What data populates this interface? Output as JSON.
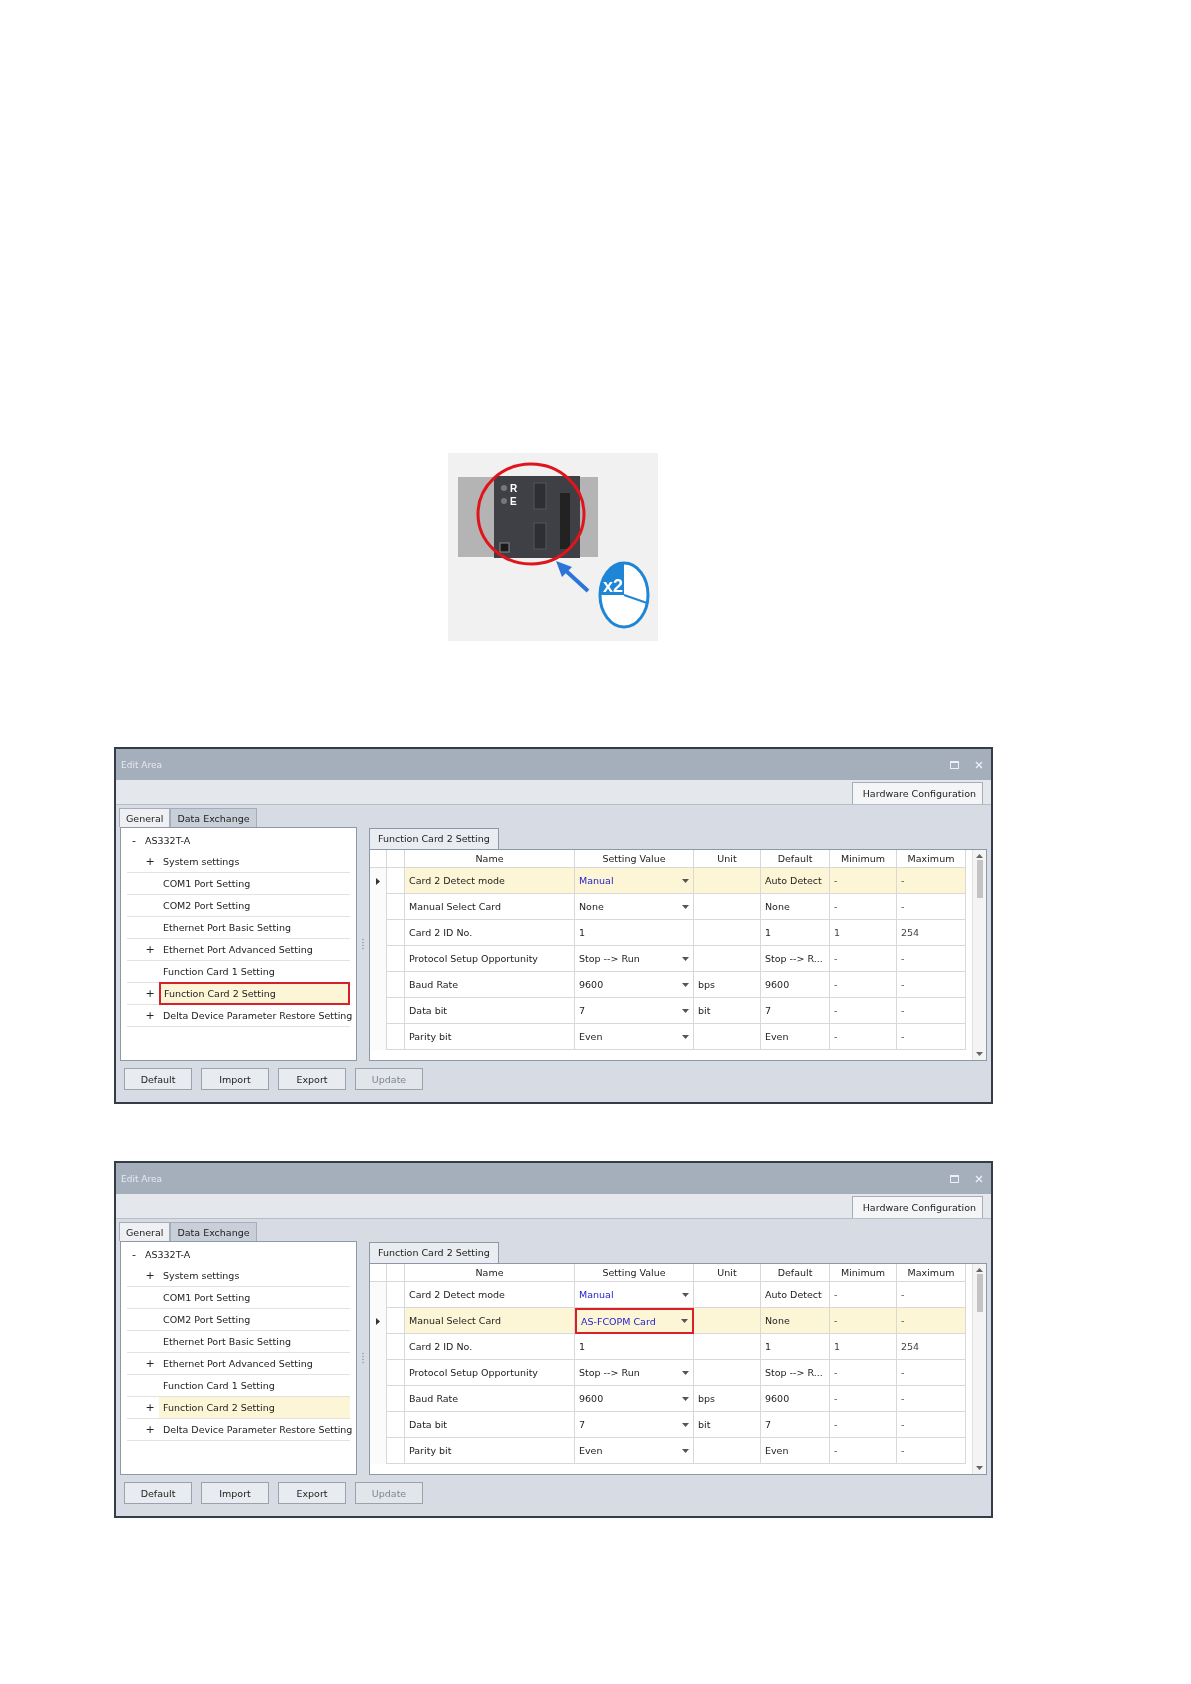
{
  "figure": {
    "status_labels": [
      "R",
      "E"
    ],
    "click_count": "x2"
  },
  "windows": [
    {
      "title": "Edit Area",
      "side_tab": "Hardware Configuration",
      "tabs": [
        {
          "label": "General",
          "selected": true
        },
        {
          "label": "Data Exchange",
          "selected": false
        }
      ],
      "tree": {
        "expander": "-",
        "label": "AS332T-A",
        "children": [
          {
            "expander": "+",
            "label": "System settings",
            "selected": false,
            "outlined": false
          },
          {
            "label": "COM1 Port Setting",
            "selected": false,
            "outlined": false
          },
          {
            "label": "COM2 Port Setting",
            "selected": false,
            "outlined": false
          },
          {
            "label": "Ethernet Port Basic Setting",
            "selected": false,
            "outlined": false
          },
          {
            "expander": "+",
            "label": "Ethernet Port Advanced Setting",
            "selected": false,
            "outlined": false
          },
          {
            "label": "Function Card 1 Setting",
            "selected": false,
            "outlined": false
          },
          {
            "expander": "+",
            "label": "Function Card 2 Setting",
            "selected": true,
            "outlined": true
          },
          {
            "expander": "+",
            "label": "Delta Device Parameter Restore Setting",
            "selected": false,
            "outlined": false
          }
        ]
      },
      "panel_tab": "Function Card 2 Setting",
      "columns": [
        "Name",
        "Setting Value",
        "Unit",
        "Default",
        "Minimum",
        "Maximum"
      ],
      "rows": [
        {
          "selected": true,
          "name": "Card 2 Detect mode",
          "setting": {
            "value": "Manual",
            "kind": "dropdown",
            "modified": true,
            "outlined": false
          },
          "default": "Auto Detect",
          "minimum": "-",
          "maximum": "-"
        },
        {
          "selected": false,
          "name": "Manual Select Card",
          "setting": {
            "value": "None",
            "kind": "dropdown",
            "modified": false,
            "outlined": false
          },
          "default": "None",
          "minimum": "-",
          "maximum": "-"
        },
        {
          "selected": false,
          "name": "Card 2 ID No.",
          "setting": {
            "value": "1",
            "kind": "text",
            "modified": false,
            "outlined": false
          },
          "default": "1",
          "minimum": "1",
          "maximum": "254"
        },
        {
          "selected": false,
          "name": "Protocol Setup Opportunity",
          "setting": {
            "value": "Stop --> Run",
            "kind": "dropdown",
            "modified": false,
            "outlined": false
          },
          "default": "Stop --> R...",
          "minimum": "-",
          "maximum": "-"
        },
        {
          "selected": false,
          "name": "Baud Rate",
          "setting": {
            "value": "9600",
            "kind": "dropdown",
            "modified": false,
            "outlined": false
          },
          "unit": "bps",
          "default": "9600",
          "minimum": "-",
          "maximum": "-"
        },
        {
          "selected": false,
          "name": "Data bit",
          "setting": {
            "value": "7",
            "kind": "dropdown",
            "modified": false,
            "outlined": false
          },
          "unit": "bit",
          "default": "7",
          "minimum": "-",
          "maximum": "-"
        },
        {
          "selected": false,
          "name": "Parity bit",
          "setting": {
            "value": "Even",
            "kind": "dropdown",
            "modified": false,
            "outlined": false
          },
          "default": "Even",
          "minimum": "-",
          "maximum": "-"
        }
      ],
      "buttons": [
        {
          "label": "Default",
          "disabled": false
        },
        {
          "label": "Import",
          "disabled": false
        },
        {
          "label": "Export",
          "disabled": false
        },
        {
          "label": "Update",
          "disabled": true
        }
      ]
    },
    {
      "title": "Edit Area",
      "side_tab": "Hardware Configuration",
      "tabs": [
        {
          "label": "General",
          "selected": true
        },
        {
          "label": "Data Exchange",
          "selected": false
        }
      ],
      "tree": {
        "expander": "-",
        "label": "AS332T-A",
        "children": [
          {
            "expander": "+",
            "label": "System settings",
            "selected": false,
            "outlined": false
          },
          {
            "label": "COM1 Port Setting",
            "selected": false,
            "outlined": false
          },
          {
            "label": "COM2 Port Setting",
            "selected": false,
            "outlined": false
          },
          {
            "label": "Ethernet Port Basic Setting",
            "selected": false,
            "outlined": false
          },
          {
            "expander": "+",
            "label": "Ethernet Port Advanced Setting",
            "selected": false,
            "outlined": false
          },
          {
            "label": "Function Card 1 Setting",
            "selected": false,
            "outlined": false
          },
          {
            "expander": "+",
            "label": "Function Card 2 Setting",
            "selected": true,
            "outlined": false
          },
          {
            "expander": "+",
            "label": "Delta Device Parameter Restore Setting",
            "selected": false,
            "outlined": false
          }
        ]
      },
      "panel_tab": "Function Card 2 Setting",
      "columns": [
        "Name",
        "Setting Value",
        "Unit",
        "Default",
        "Minimum",
        "Maximum"
      ],
      "rows": [
        {
          "selected": false,
          "name": "Card 2 Detect mode",
          "setting": {
            "value": "Manual",
            "kind": "dropdown",
            "modified": true,
            "outlined": false
          },
          "default": "Auto Detect",
          "minimum": "-",
          "maximum": "-"
        },
        {
          "selected": true,
          "name": "Manual Select Card",
          "setting": {
            "value": "AS-FCOPM Card",
            "kind": "dropdown",
            "modified": true,
            "outlined": true
          },
          "default": "None",
          "minimum": "-",
          "maximum": "-"
        },
        {
          "selected": false,
          "name": "Card 2 ID No.",
          "setting": {
            "value": "1",
            "kind": "text",
            "modified": false,
            "outlined": false
          },
          "default": "1",
          "minimum": "1",
          "maximum": "254"
        },
        {
          "selected": false,
          "name": "Protocol Setup Opportunity",
          "setting": {
            "value": "Stop --> Run",
            "kind": "dropdown",
            "modified": false,
            "outlined": false
          },
          "default": "Stop --> R...",
          "minimum": "-",
          "maximum": "-"
        },
        {
          "selected": false,
          "name": "Baud Rate",
          "setting": {
            "value": "9600",
            "kind": "dropdown",
            "modified": false,
            "outlined": false
          },
          "unit": "bps",
          "default": "9600",
          "minimum": "-",
          "maximum": "-"
        },
        {
          "selected": false,
          "name": "Data bit",
          "setting": {
            "value": "7",
            "kind": "dropdown",
            "modified": false,
            "outlined": false
          },
          "unit": "bit",
          "default": "7",
          "minimum": "-",
          "maximum": "-"
        },
        {
          "selected": false,
          "name": "Parity bit",
          "setting": {
            "value": "Even",
            "kind": "dropdown",
            "modified": false,
            "outlined": false
          },
          "default": "Even",
          "minimum": "-",
          "maximum": "-"
        }
      ],
      "buttons": [
        {
          "label": "Default",
          "disabled": false
        },
        {
          "label": "Import",
          "disabled": false
        },
        {
          "label": "Export",
          "disabled": false
        },
        {
          "label": "Update",
          "disabled": true
        }
      ]
    }
  ]
}
